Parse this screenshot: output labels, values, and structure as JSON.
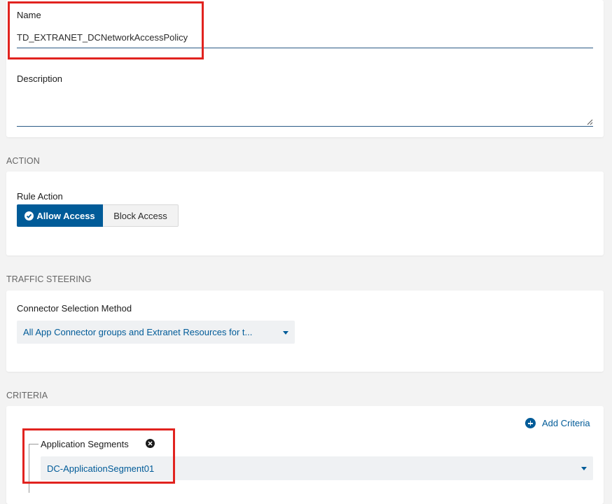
{
  "general": {
    "name_label": "Name",
    "name_value": "TD_EXTRANET_DCNetworkAccessPolicy",
    "description_label": "Description",
    "description_value": ""
  },
  "action": {
    "section_title": "ACTION",
    "rule_action_label": "Rule Action",
    "allow_label": "Allow Access",
    "block_label": "Block Access",
    "selected": "Allow Access"
  },
  "traffic_steering": {
    "section_title": "TRAFFIC STEERING",
    "connector_label": "Connector Selection Method",
    "connector_value": "All App Connector groups and Extranet Resources for t..."
  },
  "criteria": {
    "section_title": "CRITERIA",
    "add_criteria_label": "Add Criteria",
    "app_segments_label": "Application Segments",
    "app_segment_value": "DC-ApplicationSegment01"
  },
  "icons": {
    "allow": "check-circle-icon",
    "add_criteria": "plus-circle-icon",
    "remove_segment": "close-circle-icon",
    "dropdown": "caret-down-icon"
  },
  "colors": {
    "accent": "#005b98",
    "highlight": "#e1231f",
    "background": "#f3f3f3"
  }
}
